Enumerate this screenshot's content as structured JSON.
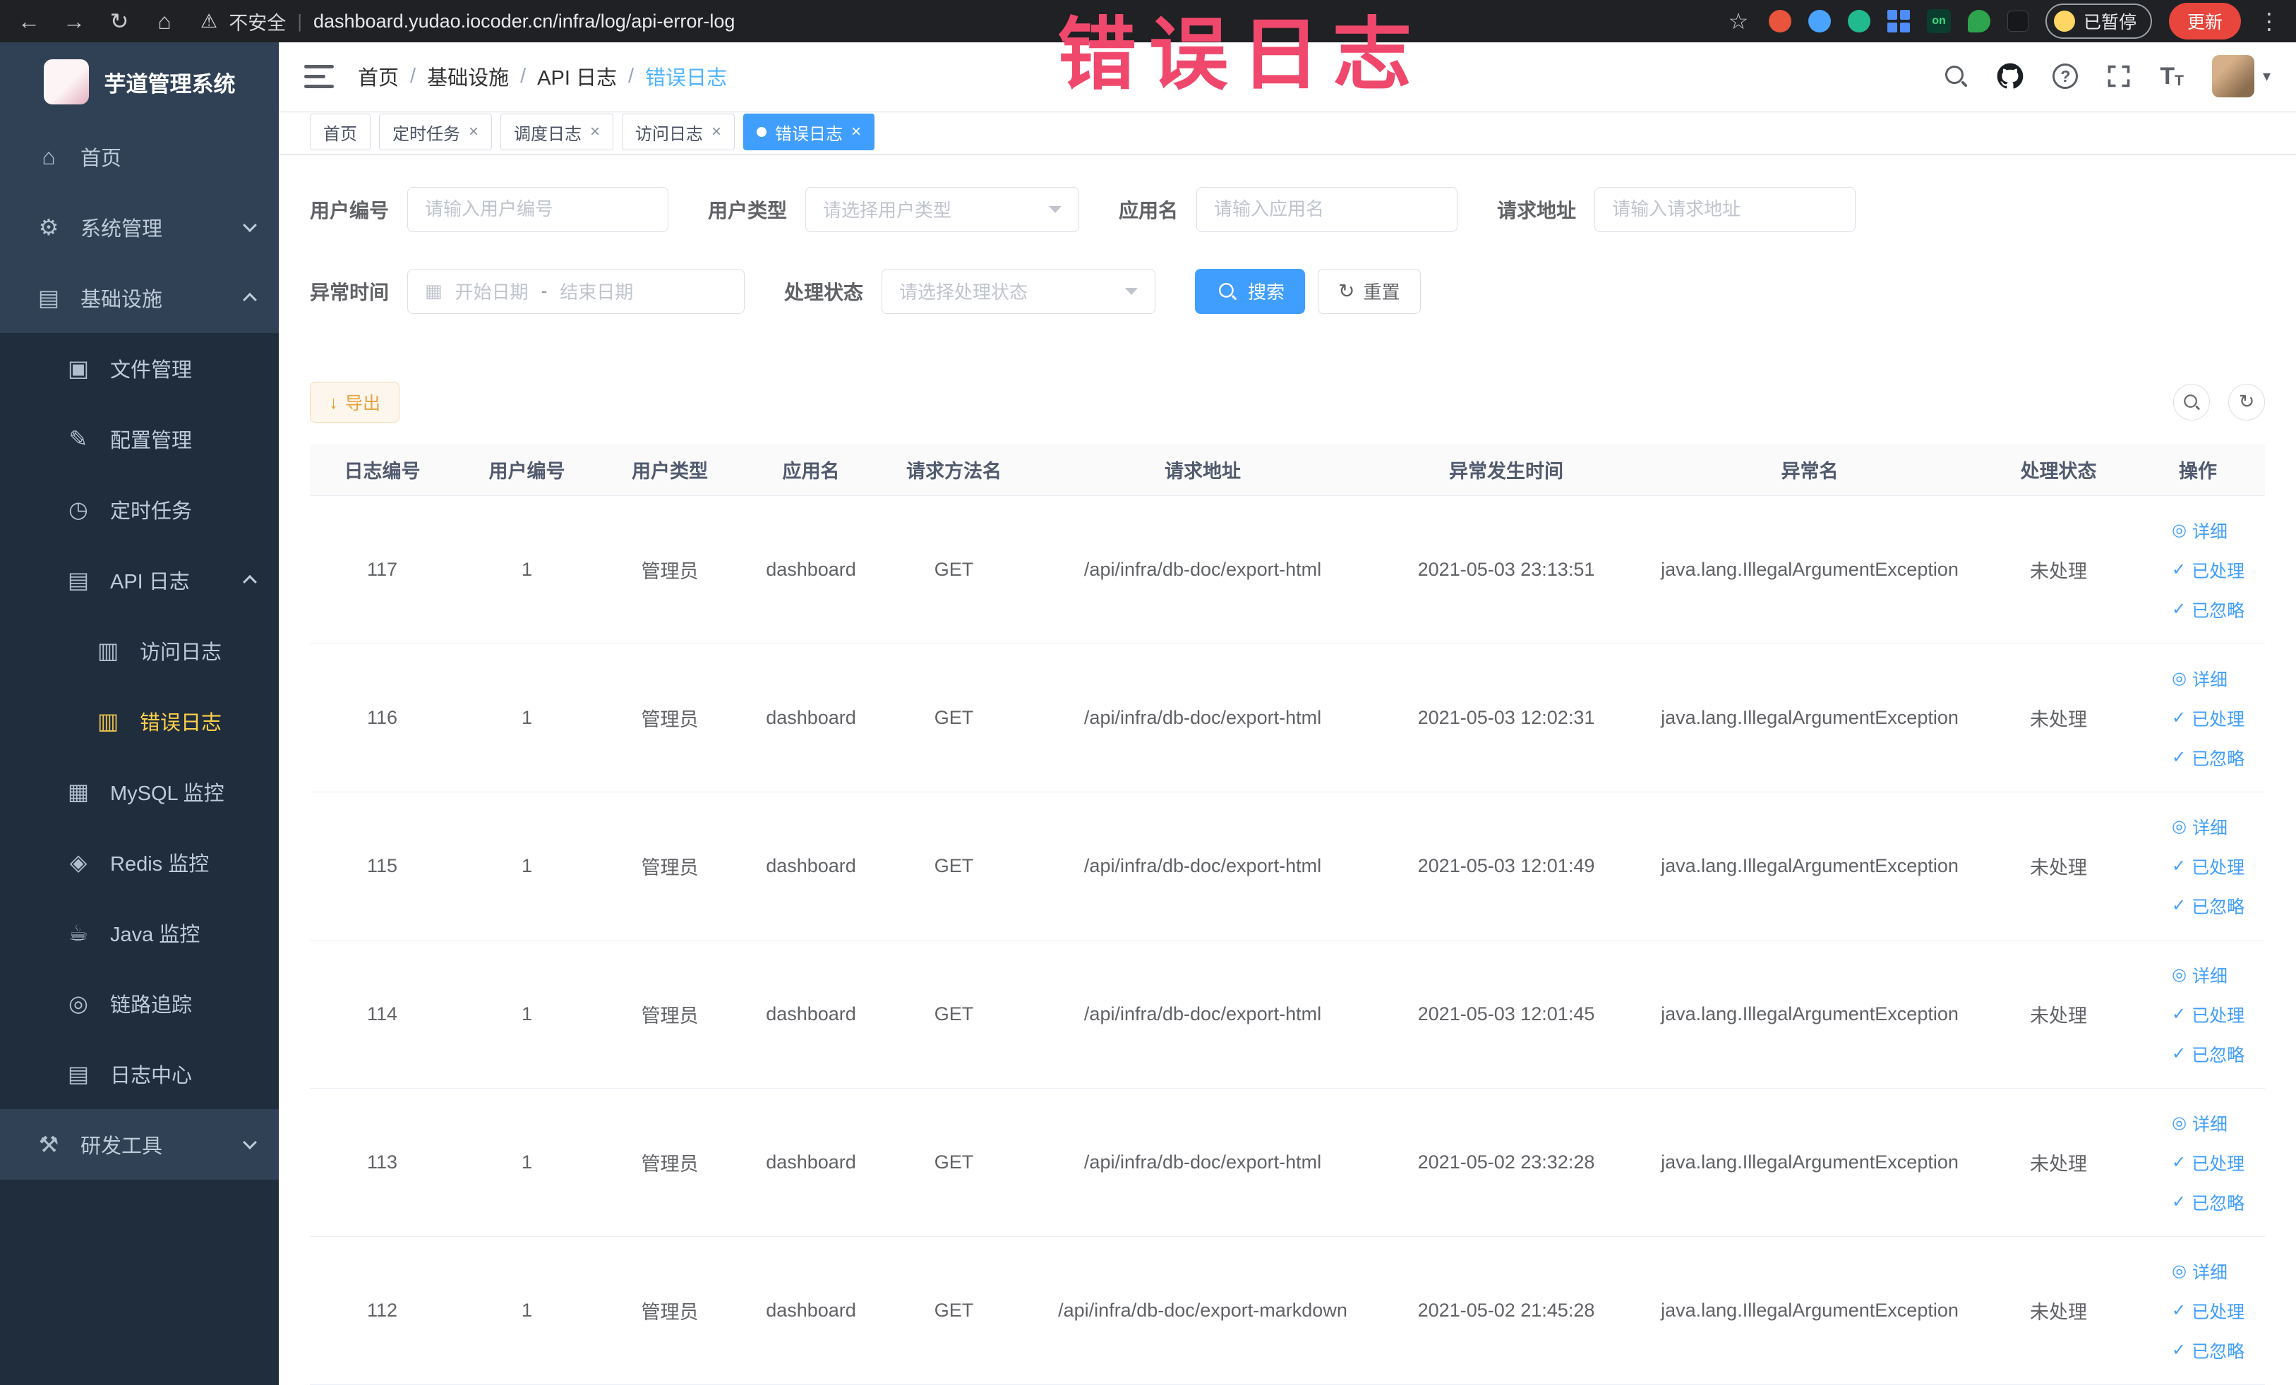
{
  "browser": {
    "security_label": "不安全",
    "url": "dashboard.yudao.iocoder.cn/infra/log/api-error-log",
    "paused_badge": "已暂停",
    "update_button": "更新"
  },
  "icons": {
    "back": "←",
    "forward": "→",
    "reload": "↻",
    "home": "⌂",
    "warning": "⚠",
    "star": "☆",
    "more": "⋮",
    "caret": "▾",
    "question": "?",
    "close": "×",
    "calendar": "▦",
    "refresh": "↻",
    "download": "↓",
    "check": "✓",
    "view": "◎",
    "ext_on": "on"
  },
  "watermark": "错误日志",
  "sidebar": {
    "title": "芋道管理系统",
    "items": [
      {
        "label": "首页",
        "icon": "⌂"
      },
      {
        "label": "系统管理",
        "icon": "⚙"
      },
      {
        "label": "基础设施",
        "icon": "▤"
      },
      {
        "label": "文件管理",
        "icon": "▣"
      },
      {
        "label": "配置管理",
        "icon": "✎"
      },
      {
        "label": "定时任务",
        "icon": "◷"
      },
      {
        "label": "API 日志",
        "icon": "▤"
      },
      {
        "label": "访问日志",
        "icon": "▥"
      },
      {
        "label": "错误日志",
        "icon": "▥"
      },
      {
        "label": "MySQL 监控",
        "icon": "▦"
      },
      {
        "label": "Redis 监控",
        "icon": "◈"
      },
      {
        "label": "Java 监控",
        "icon": "☕"
      },
      {
        "label": "链路追踪",
        "icon": "◎"
      },
      {
        "label": "日志中心",
        "icon": "▤"
      },
      {
        "label": "研发工具",
        "icon": "⚒"
      }
    ]
  },
  "header": {
    "breadcrumb": [
      "首页",
      "基础设施",
      "API 日志",
      "错误日志"
    ],
    "breadcrumb_separator": "/"
  },
  "tabs": [
    {
      "label": "首页"
    },
    {
      "label": "定时任务"
    },
    {
      "label": "调度日志"
    },
    {
      "label": "访问日志"
    },
    {
      "label": "错误日志"
    }
  ],
  "filters": {
    "user_id": {
      "label": "用户编号",
      "placeholder": "请输入用户编号"
    },
    "user_type": {
      "label": "用户类型",
      "placeholder": "请选择用户类型"
    },
    "app_name": {
      "label": "应用名",
      "placeholder": "请输入应用名"
    },
    "request_url": {
      "label": "请求地址",
      "placeholder": "请输入请求地址"
    },
    "exception_time": {
      "label": "异常时间",
      "start_placeholder": "开始日期",
      "separator": "-",
      "end_placeholder": "结束日期"
    },
    "process_status": {
      "label": "处理状态",
      "placeholder": "请选择处理状态"
    },
    "search_button": "搜索",
    "reset_button": "重置"
  },
  "toolbar": {
    "export_button": "导出"
  },
  "table": {
    "columns": [
      "日志编号",
      "用户编号",
      "用户类型",
      "应用名",
      "请求方法名",
      "请求地址",
      "异常发生时间",
      "异常名",
      "处理状态",
      "操作"
    ],
    "actions": {
      "detail": "详细",
      "processed": "已处理",
      "ignored": "已忽略"
    },
    "rows": [
      {
        "id": "117",
        "user_id": "1",
        "user_type": "管理员",
        "app": "dashboard",
        "method": "GET",
        "url": "/api/infra/db-doc/export-html",
        "time": "2021-05-03 23:13:51",
        "exception": "java.lang.IllegalArgumentException",
        "status": "未处理"
      },
      {
        "id": "116",
        "user_id": "1",
        "user_type": "管理员",
        "app": "dashboard",
        "method": "GET",
        "url": "/api/infra/db-doc/export-html",
        "time": "2021-05-03 12:02:31",
        "exception": "java.lang.IllegalArgumentException",
        "status": "未处理"
      },
      {
        "id": "115",
        "user_id": "1",
        "user_type": "管理员",
        "app": "dashboard",
        "method": "GET",
        "url": "/api/infra/db-doc/export-html",
        "time": "2021-05-03 12:01:49",
        "exception": "java.lang.IllegalArgumentException",
        "status": "未处理"
      },
      {
        "id": "114",
        "user_id": "1",
        "user_type": "管理员",
        "app": "dashboard",
        "method": "GET",
        "url": "/api/infra/db-doc/export-html",
        "time": "2021-05-03 12:01:45",
        "exception": "java.lang.IllegalArgumentException",
        "status": "未处理"
      },
      {
        "id": "113",
        "user_id": "1",
        "user_type": "管理员",
        "app": "dashboard",
        "method": "GET",
        "url": "/api/infra/db-doc/export-html",
        "time": "2021-05-02 23:32:28",
        "exception": "java.lang.IllegalArgumentException",
        "status": "未处理"
      },
      {
        "id": "112",
        "user_id": "1",
        "user_type": "管理员",
        "app": "dashboard",
        "method": "GET",
        "url": "/api/infra/db-doc/export-markdown",
        "time": "2021-05-02 21:45:28",
        "exception": "java.lang.IllegalArgumentException",
        "status": "未处理"
      }
    ]
  }
}
